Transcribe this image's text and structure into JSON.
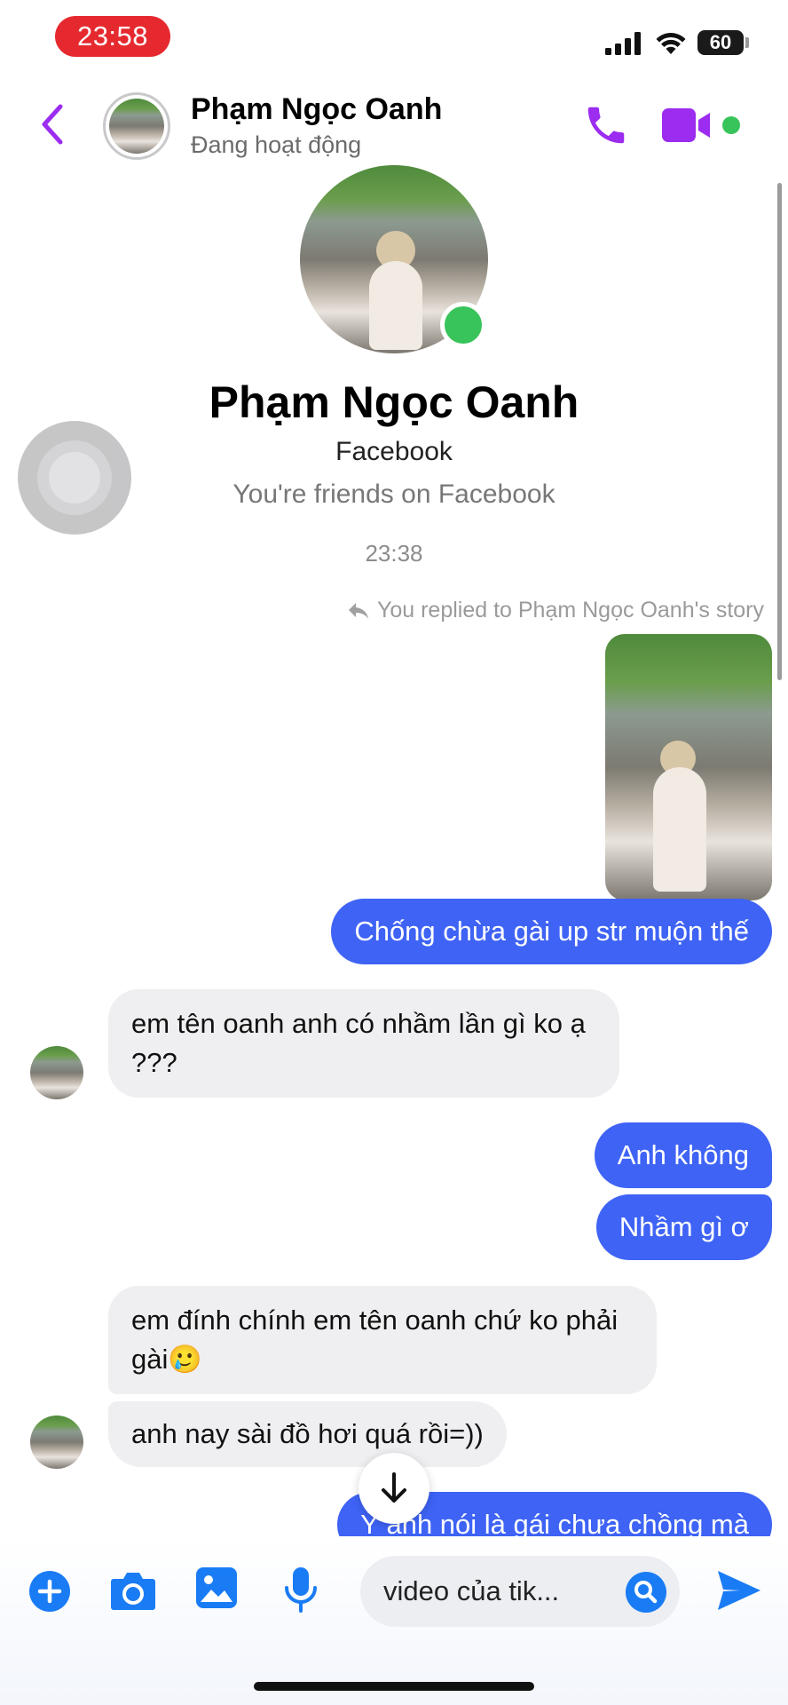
{
  "status_bar": {
    "time": "23:58",
    "battery": "60"
  },
  "header": {
    "contact_name": "Phạm Ngọc Oanh",
    "status": "Đang hoạt động"
  },
  "profile": {
    "name": "Phạm Ngọc Oanh",
    "platform": "Facebook",
    "relationship": "You're friends on Facebook"
  },
  "conversation": {
    "timestamp": "23:38",
    "reply_note": "You replied to Phạm Ngọc Oanh's story",
    "messages": [
      {
        "sender": "me",
        "text": "Chống chừa gài up str muộn thế"
      },
      {
        "sender": "them",
        "text": "em tên oanh anh có nhầm lần gì ko ạ ???"
      },
      {
        "sender": "me",
        "text": "Anh không"
      },
      {
        "sender": "me",
        "text": "Nhầm gì ơ"
      },
      {
        "sender": "them",
        "text": "em đính chính em tên oanh chứ ko phải gài🥲"
      },
      {
        "sender": "them",
        "text": "anh nay sài đồ hơi quá rồi=))"
      },
      {
        "sender": "me",
        "text": "Ý anh nói là gái chưa chồng mà"
      }
    ]
  },
  "composer": {
    "input_value": "video của tik...",
    "icons": [
      "plus-icon",
      "camera-icon",
      "gallery-icon",
      "microphone-icon",
      "search-icon",
      "send-icon"
    ]
  },
  "colors": {
    "accent_purple": "#9b2cf0",
    "outgoing_bubble": "#3e63f5",
    "incoming_bubble": "#efeff1",
    "online_green": "#39c35b",
    "composer_icon_blue": "#1a7cf5"
  }
}
